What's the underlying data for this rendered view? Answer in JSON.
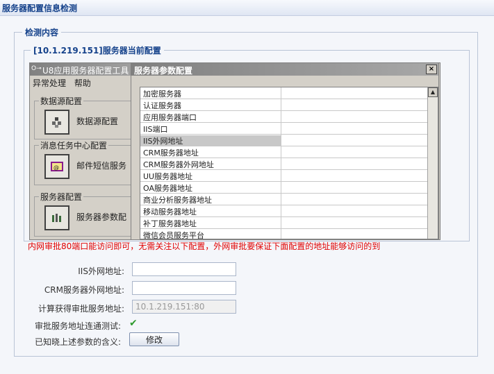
{
  "page_title": "服务器配置信息检测",
  "section_title": "检测内容",
  "subsection_title": "[10.1.219.151]服务器当前配置",
  "app": {
    "title": "U8应用服务器配置工具",
    "menu": [
      "异常处理",
      "帮助"
    ],
    "groups": [
      {
        "label": "数据源配置",
        "button_label": "数据源配置"
      },
      {
        "label": "消息任务中心配置",
        "button_label": "邮件短信服务"
      },
      {
        "label": "服务器配置",
        "button_label": "服务器参数配"
      }
    ]
  },
  "dialog": {
    "title": "服务器参数配置",
    "close": "×",
    "items": [
      "加密服务器",
      "认证服务器",
      "应用服务器端口",
      "IIS端口",
      "IIS外网地址",
      "CRM服务器地址",
      "CRM服务器外网地址",
      "UU服务器地址",
      "OA服务器地址",
      "商业分析服务器地址",
      "移动服务器地址",
      "补丁服务器地址",
      "微信会员服务平台"
    ],
    "selected_index": 4
  },
  "note": "内网审批80端口能访问即可，无需关注以下配置，外网审批要保证下面配置的地址能够访问的到",
  "form": {
    "iis_label": "IIS外网地址:",
    "iis_value": "",
    "crm_label": "CRM服务器外网地址:",
    "crm_value": "",
    "calc_label": "计算获得审批服务地址:",
    "calc_value": "10.1.219.151:80",
    "test_label": "审批服务地址连通测试:",
    "confirm_label": "已知晓上述参数的含义:",
    "modify_button": "修改"
  }
}
